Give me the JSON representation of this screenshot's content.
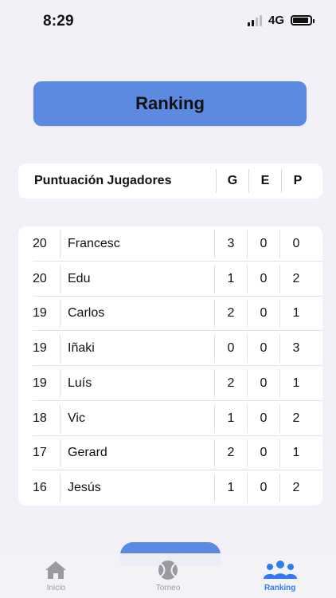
{
  "status_bar": {
    "time": "8:29",
    "network": "4G"
  },
  "title_button": "Ranking",
  "header": {
    "title": "Puntuación Jugadores",
    "columns": [
      "G",
      "E",
      "P"
    ]
  },
  "players": [
    {
      "points": "20",
      "name": "Francesc",
      "g": "3",
      "e": "0",
      "p": "0"
    },
    {
      "points": "20",
      "name": "Edu",
      "g": "1",
      "e": "0",
      "p": "2"
    },
    {
      "points": "19",
      "name": "Carlos",
      "g": "2",
      "e": "0",
      "p": "1"
    },
    {
      "points": "19",
      "name": "Iñaki",
      "g": "0",
      "e": "0",
      "p": "3"
    },
    {
      "points": "19",
      "name": "Luís",
      "g": "2",
      "e": "0",
      "p": "1"
    },
    {
      "points": "18",
      "name": "Vic",
      "g": "1",
      "e": "0",
      "p": "2"
    },
    {
      "points": "17",
      "name": "Gerard",
      "g": "2",
      "e": "0",
      "p": "1"
    },
    {
      "points": "16",
      "name": "Jesús",
      "g": "1",
      "e": "0",
      "p": "2"
    }
  ],
  "tabs": [
    {
      "label": "Inicio",
      "icon": "house-icon",
      "active": false
    },
    {
      "label": "Torneo",
      "icon": "tennis-ball-icon",
      "active": false
    },
    {
      "label": "Ranking",
      "icon": "people-icon",
      "active": true
    }
  ],
  "colors": {
    "accent": "#5b8ae0",
    "active_tab": "#2f7cf6",
    "background": "#f2f1f7"
  }
}
